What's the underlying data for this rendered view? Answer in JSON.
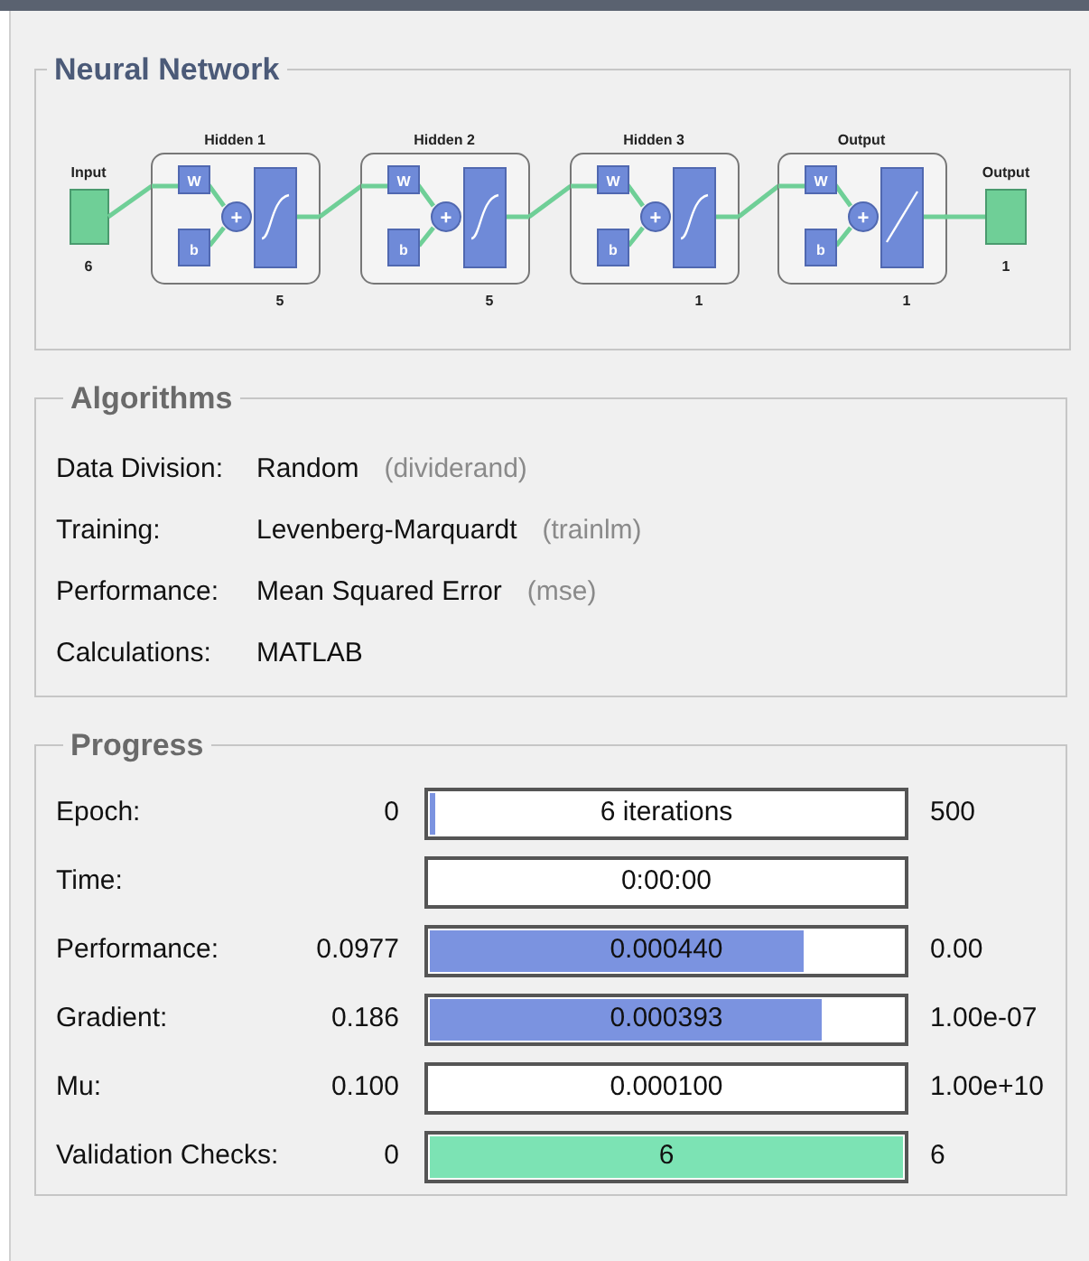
{
  "network": {
    "title": "Neural Network",
    "input": {
      "label": "Input",
      "size": "6"
    },
    "layers": [
      {
        "title": "Hidden 1",
        "size": "5",
        "weight_label": "W",
        "bias_label": "b",
        "sum_symbol": "+",
        "kind": "sigmoid"
      },
      {
        "title": "Hidden 2",
        "size": "5",
        "weight_label": "W",
        "bias_label": "b",
        "sum_symbol": "+",
        "kind": "sigmoid"
      },
      {
        "title": "Hidden 3",
        "size": "1",
        "weight_label": "W",
        "bias_label": "b",
        "sum_symbol": "+",
        "kind": "sigmoid"
      },
      {
        "title": "Output",
        "size": "1",
        "weight_label": "W",
        "bias_label": "b",
        "sum_symbol": "+",
        "kind": "linear"
      }
    ],
    "output": {
      "label": "Output",
      "size": "1"
    }
  },
  "algorithms": {
    "title": "Algorithms",
    "rows": [
      {
        "label": "Data Division:",
        "value": "Random",
        "function": "(dividerand)"
      },
      {
        "label": "Training:",
        "value": "Levenberg-Marquardt",
        "function": "(trainlm)"
      },
      {
        "label": "Performance:",
        "value": "Mean Squared Error",
        "function": "(mse)"
      },
      {
        "label": "Calculations:",
        "value": "MATLAB"
      }
    ]
  },
  "progress": {
    "title": "Progress",
    "rows": [
      {
        "label": "Epoch:",
        "start": "0",
        "bar_text": "6 iterations",
        "level": 0.012,
        "color": "#7b93e0",
        "end": "500"
      },
      {
        "label": "Time:",
        "bar_text": "0:00:00"
      },
      {
        "label": "Performance:",
        "start": "0.0977",
        "bar_text": "0.000440",
        "level": 0.79,
        "color": "#7b93e0",
        "end": "0.00"
      },
      {
        "label": "Gradient:",
        "start": "0.186",
        "bar_text": "0.000393",
        "level": 0.83,
        "color": "#7b93e0",
        "end": "1.00e-07"
      },
      {
        "label": "Mu:",
        "start": "0.100",
        "bar_text": "0.000100",
        "end": "1.00e+10"
      },
      {
        "label": "Validation Checks:",
        "start": "0",
        "bar_text": "6",
        "level": 1,
        "color": "#7ce3b4",
        "end": "6"
      }
    ]
  }
}
